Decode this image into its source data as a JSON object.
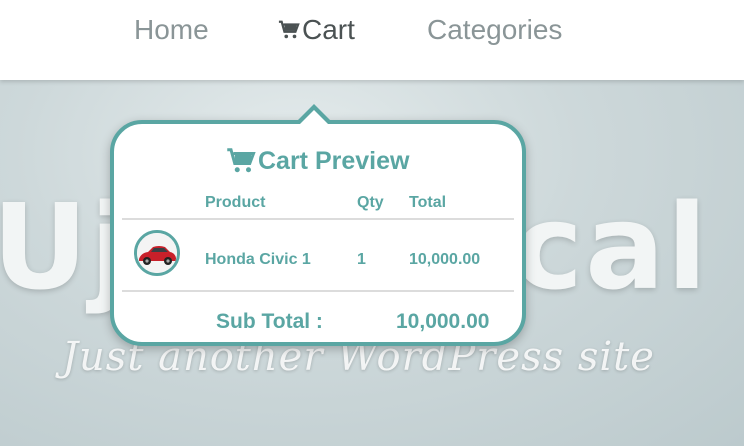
{
  "nav": {
    "items": [
      {
        "label": "Home"
      },
      {
        "label": "Cart",
        "icon": "cart-icon",
        "active": true
      },
      {
        "label": "Categories"
      }
    ]
  },
  "hero": {
    "site_title": "UjWPLocal",
    "tagline": "Just another WordPress site"
  },
  "cart_preview": {
    "title": "Cart Preview",
    "title_icon": "cart-icon",
    "columns": [
      "Product",
      "Qty",
      "Total"
    ],
    "items": [
      {
        "name": "Honda Civic 1",
        "qty": "1",
        "total": "10,000.00",
        "thumbnail": "red-car-image"
      }
    ],
    "subtotal_label": "Sub Total :",
    "subtotal_value": "10,000.00"
  },
  "colors": {
    "accent": "#5aa6a3",
    "nav_text": "#8a9597",
    "nav_active": "#4b5253"
  }
}
